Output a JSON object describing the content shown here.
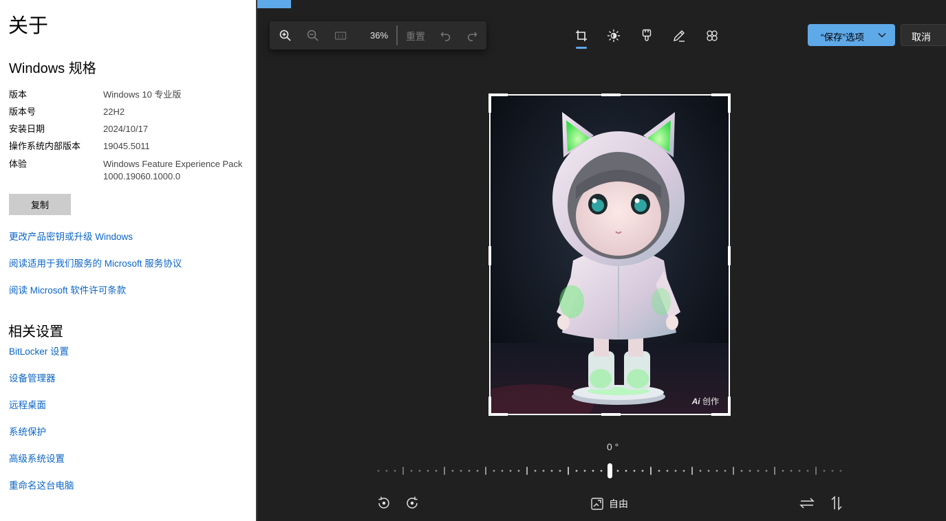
{
  "settings": {
    "title": "关于",
    "spec_heading": "Windows 规格",
    "specs": [
      {
        "key": "版本",
        "value": "Windows 10 专业版"
      },
      {
        "key": "版本号",
        "value": "22H2"
      },
      {
        "key": "安装日期",
        "value": "2024/10/17"
      },
      {
        "key": "操作系统内部版本",
        "value": "19045.5011"
      },
      {
        "key": "体验",
        "value": "Windows Feature Experience Pack 1000.19060.1000.0"
      }
    ],
    "copy_label": "复制",
    "links": [
      "更改产品密钥或升级 Windows",
      "阅读适用于我们服务的 Microsoft 服务协议",
      "阅读 Microsoft 软件许可条款"
    ],
    "related_heading": "相关设置",
    "related_links": [
      "BitLocker 设置",
      "设备管理器",
      "远程桌面",
      "系统保护",
      "高级系统设置",
      "重命名这台电脑"
    ]
  },
  "editor": {
    "zoom_percent": "36%",
    "reset_label": "重置",
    "save_label": "“保存”选项",
    "cancel_label": "取消",
    "watermark": "创作",
    "rotation_angle": "0 °",
    "aspect_label": "自由",
    "icons": {
      "zoom_in": "zoom-in-icon",
      "zoom_out": "zoom-out-icon",
      "actual_size": "actual-size-icon",
      "undo": "undo-icon",
      "redo": "redo-icon",
      "crop": "crop-icon",
      "adjust": "brightness-icon",
      "filter": "filter-icon",
      "markup": "pen-icon",
      "spot_fix": "spot-fix-icon",
      "rotate_left": "rotate-left-icon",
      "rotate_right": "rotate-right-icon",
      "flip_h": "flip-horizontal-icon",
      "flip_v": "flip-vertical-icon",
      "aspect": "aspect-ratio-icon"
    },
    "colors": {
      "accent": "#5ea9e8",
      "canvas": "#202020",
      "link": "#0a64c8"
    }
  }
}
